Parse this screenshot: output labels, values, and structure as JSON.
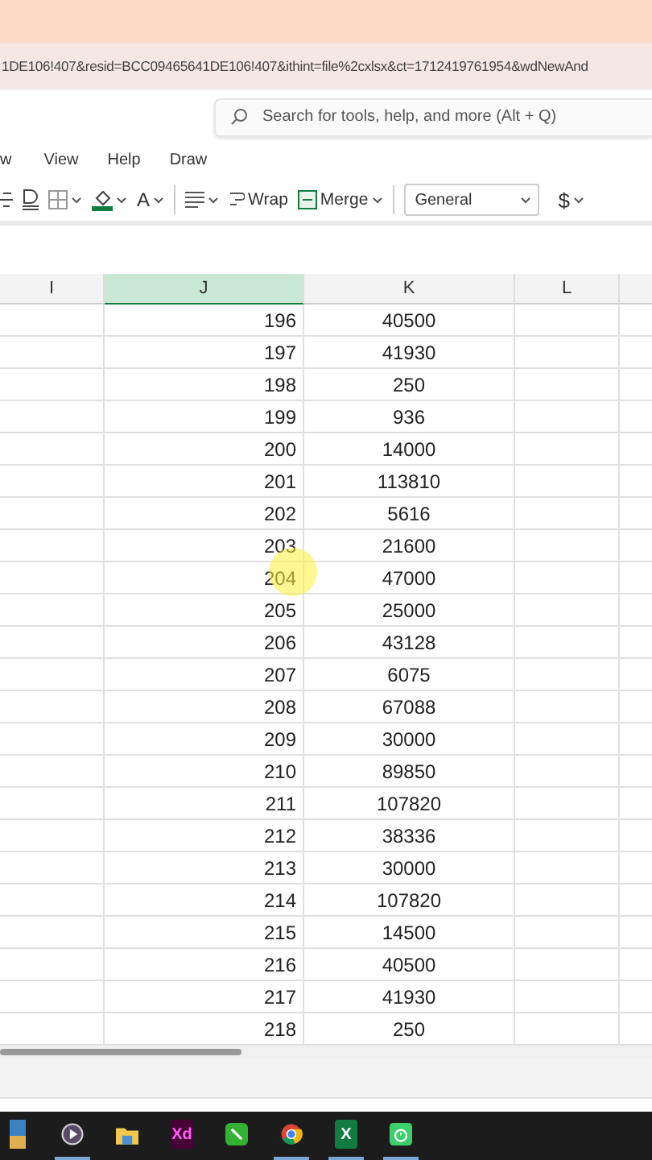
{
  "address_bar": {
    "url": "1DE106!407&resid=BCC09465641DE106!407&ithint=file%2cxlsx&ct=1712419761954&wdNewAnd"
  },
  "search": {
    "placeholder": "Search for tools, help, and more (Alt + Q)"
  },
  "menu_tabs": [
    {
      "label": "w",
      "selected": false
    },
    {
      "label": "View",
      "selected": false
    },
    {
      "label": "Help",
      "selected": false
    },
    {
      "label": "Draw",
      "selected": false
    }
  ],
  "toolbar": {
    "wrap": "Wrap",
    "merge": "Merge",
    "number_format": "General",
    "font_color_letter": "A",
    "currency": "$"
  },
  "columns": [
    {
      "label": "I",
      "selected": false
    },
    {
      "label": "J",
      "selected": true
    },
    {
      "label": "K",
      "selected": false
    },
    {
      "label": "L",
      "selected": false
    }
  ],
  "rows": [
    [
      "196",
      "40500"
    ],
    [
      "197",
      "41930"
    ],
    [
      "198",
      "250"
    ],
    [
      "199",
      "936"
    ],
    [
      "200",
      "14000"
    ],
    [
      "201",
      "113810"
    ],
    [
      "202",
      "5616"
    ],
    [
      "203",
      "21600"
    ],
    [
      "204",
      "47000"
    ],
    [
      "205",
      "25000"
    ],
    [
      "206",
      "43128"
    ],
    [
      "207",
      "6075"
    ],
    [
      "208",
      "67088"
    ],
    [
      "209",
      "30000"
    ],
    [
      "210",
      "89850"
    ],
    [
      "211",
      "107820"
    ],
    [
      "212",
      "38336"
    ],
    [
      "213",
      "30000"
    ],
    [
      "214",
      "107820"
    ],
    [
      "215",
      "14500"
    ],
    [
      "216",
      "40500"
    ],
    [
      "217",
      "41930"
    ],
    [
      "218",
      "250"
    ]
  ],
  "taskbar": [
    {
      "kind": "photos",
      "active": false
    },
    {
      "kind": "player",
      "active": true
    },
    {
      "kind": "folder",
      "active": false
    },
    {
      "kind": "xd",
      "glyph": "Xd",
      "active": false
    },
    {
      "kind": "green",
      "active": false
    },
    {
      "kind": "chrome",
      "active": true
    },
    {
      "kind": "excel",
      "glyph": "X",
      "active": true
    },
    {
      "kind": "timer",
      "active": true
    }
  ]
}
